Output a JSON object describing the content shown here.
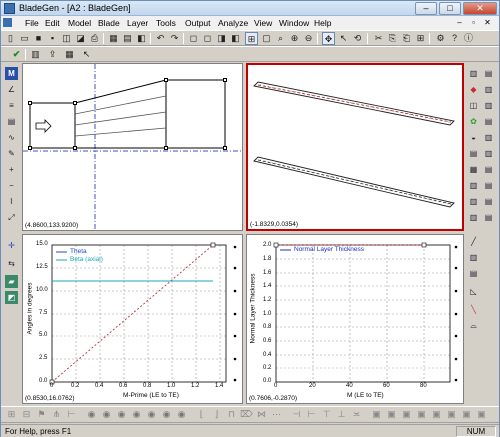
{
  "window": {
    "title": "BladeGen - [A2 : BladeGen]",
    "min": "–",
    "max": "□",
    "close": "✕"
  },
  "menu": [
    "File",
    "Edit",
    "Model",
    "Blade",
    "Layer",
    "Tools",
    "Output",
    "Analyze",
    "View",
    "Window",
    "Help"
  ],
  "mdi": {
    "min": "–",
    "restore": "▫",
    "close": "✕"
  },
  "panes": {
    "meridional": {
      "coord": "(4.8600,133.9200)"
    },
    "view3d": {
      "coord": "(-1.8329,0.0354)"
    },
    "angle": {
      "coord": "(0.8530,16.0762)",
      "ylabel": "Angles in degrees",
      "xlabel": "M-Prime (LE to TE)",
      "legend": [
        "Theta",
        "Beta (axial)"
      ],
      "yticks": [
        "15.0",
        "12.5",
        "10.0",
        "7.5",
        "5.0",
        "2.5",
        "0.0"
      ],
      "xticks": [
        "0",
        "0.2",
        "0.4",
        "0.6",
        "0.8",
        "1.0",
        "1.2",
        "1.4"
      ]
    },
    "thickness": {
      "coord": "(0.7606,-0.2870)",
      "ylabel": "Normal Layer Thickness",
      "xlabel": "M (LE to TE)",
      "legend": [
        "Normal Layer Thickness"
      ],
      "yticks": [
        "2.0",
        "1.8",
        "1.6",
        "1.4",
        "1.2",
        "1.0",
        "0.8",
        "0.6",
        "0.4",
        "0.2",
        "0.0"
      ],
      "xticks": [
        "0",
        "20",
        "40",
        "60",
        "80"
      ]
    }
  },
  "colors": {
    "theta": "#1f4fc8",
    "beta": "#19a8b8",
    "dashed": "#c0303a",
    "thickness": "#2030c0",
    "active_border": "#c00000"
  },
  "status": {
    "help": "For Help, press F1",
    "num": "NUM"
  }
}
